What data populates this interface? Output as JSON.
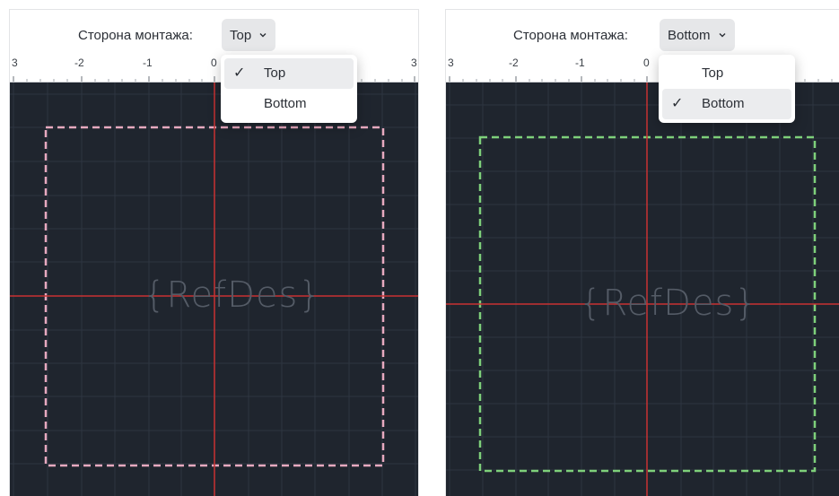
{
  "left_panel": {
    "label": "Сторона монтажа:",
    "selected_value": "Top",
    "ruler_labels": [
      "3",
      "-2",
      "-1",
      "0",
      "3"
    ],
    "refdes": "{RefDes}",
    "outline_color": "#e7a9bf",
    "menu": [
      {
        "label": "Top",
        "checked": true,
        "check": "✓"
      },
      {
        "label": "Bottom",
        "checked": false,
        "check": ""
      }
    ]
  },
  "right_panel": {
    "label": "Сторона монтажа:",
    "selected_value": "Bottom",
    "ruler_labels": [
      "3",
      "-2",
      "-1",
      "0"
    ],
    "refdes": "{RefDes}",
    "outline_color": "#7ed07a",
    "menu": [
      {
        "label": "Top",
        "checked": false,
        "check": ""
      },
      {
        "label": "Bottom",
        "checked": true,
        "check": "✓"
      }
    ]
  },
  "colors": {
    "canvas_bg": "#1f252e",
    "grid": "#2e3540",
    "axis": "#c83232"
  },
  "icons": {
    "select_arrow": "chevron-down-icon",
    "checked_option": "checkmark-icon"
  }
}
